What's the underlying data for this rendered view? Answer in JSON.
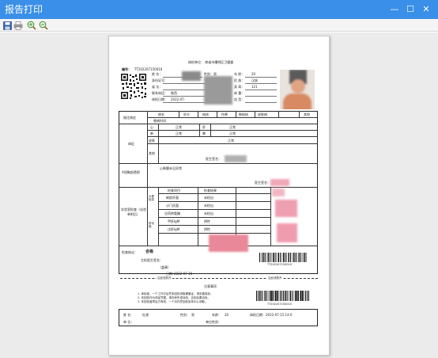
{
  "window": {
    "title": "报告打印",
    "title_bar_color": "#3a8fe8",
    "controls": {
      "minimize": "—",
      "maximize": "☐",
      "close": "✕"
    }
  },
  "toolbar": {
    "buttons": [
      {
        "name": "save",
        "icon": "floppy-disk-icon"
      },
      {
        "name": "print",
        "icon": "printer-icon"
      },
      {
        "name": "zoom-in",
        "icon": "zoom-in-icon"
      },
      {
        "name": "zoom-out",
        "icon": "zoom-out-icon"
      }
    ]
  },
  "report": {
    "org_line": "体检单位：  商省市播明区卫健委",
    "no_label": "编号：",
    "no_value": "TT202207150010",
    "info_rows": [
      {
        "l1": "姓    名：",
        "l2": "性别：",
        "v2": "男",
        "l3": "年    龄：",
        "v3": "20"
      },
      {
        "l1": "身份证号：",
        "l2": "",
        "v2": "",
        "l3": "民    族：",
        "v3": "汉族"
      },
      {
        "l1": "省    址：",
        "l2": "",
        "v2": "",
        "l3": "身    高：",
        "v3": "121"
      },
      {
        "l1": "联系电话：",
        "l2": "",
        "v2": "陕西",
        "l3": "体    重：",
        "v3": ""
      },
      {
        "l1": "体检日期：",
        "l2": "",
        "v2": "2022-07-",
        "l3": "血    型：",
        "v3": ""
      }
    ],
    "history": {
      "label": "既往病史",
      "headers": [
        "病名",
        "肝炎",
        "结核",
        "伤寒",
        "肺结核",
        "皮肤病",
        "其他"
      ],
      "row2": "患病时间"
    },
    "physical": {
      "label": "体征",
      "row_labels": [
        "心",
        "肺",
        "皮肤",
        "其他"
      ],
      "normal": "正常",
      "mid_labels": [
        "肝",
        "脾"
      ],
      "doctor_sign": "医生签名："
    },
    "xray": {
      "label": "X线胸部透视",
      "result": "心肺膈未见异常",
      "doctor_sign": "医生签名："
    },
    "lab": {
      "label": "实验室检查（化验单附后）",
      "sub_label1": "大便检查",
      "sub_label2": "肝功能",
      "headers": [
        "检查项目",
        "检查结果"
      ],
      "rows": [
        {
          "item": "痢疾杆菌",
          "result": "未检出"
        },
        {
          "item": "沙门氏菌",
          "result": "未检出"
        },
        {
          "item": "谷丙转氨酶",
          "result": "未检出"
        },
        {
          "item": "甲肝IgM",
          "result": "阴性"
        },
        {
          "item": "戊肝IgM",
          "result": "阴性"
        }
      ]
    },
    "conclusion": {
      "label": "检查结论：",
      "value": "合格",
      "sign_label": "主检医生签名：",
      "stamp": "（盖章）",
      "date_label": "日期：",
      "date_value": "2022-07-16",
      "barcode_text": "TT202207150010"
    },
    "cut_line": {
      "left": "沿此线剪开",
      "right": "沿此线剪开"
    },
    "notice": {
      "title": "注意事项",
      "lines": [
        "1. 体检者，一个工作日后凭本回执领取健康证。请妥善保存。",
        "2. 本回执作为领证凭据，请勿丢失或涂改，否则后果自负。",
        "3. 本回执盖章后方有效，一个月内凭回执到本中心领取。"
      ],
      "barcode_text": "TT202207150010"
    },
    "footer": {
      "name_label": "姓    名：",
      "name_value": "杜源",
      "sex_label": "性别：",
      "sex_value": "男",
      "age_label": "年龄：",
      "age_value": "20",
      "date_label": "体检日期：",
      "date_value": "2022-07-15 14:0",
      "unit_label": "单    位：",
      "org_label": "单位性质："
    }
  }
}
